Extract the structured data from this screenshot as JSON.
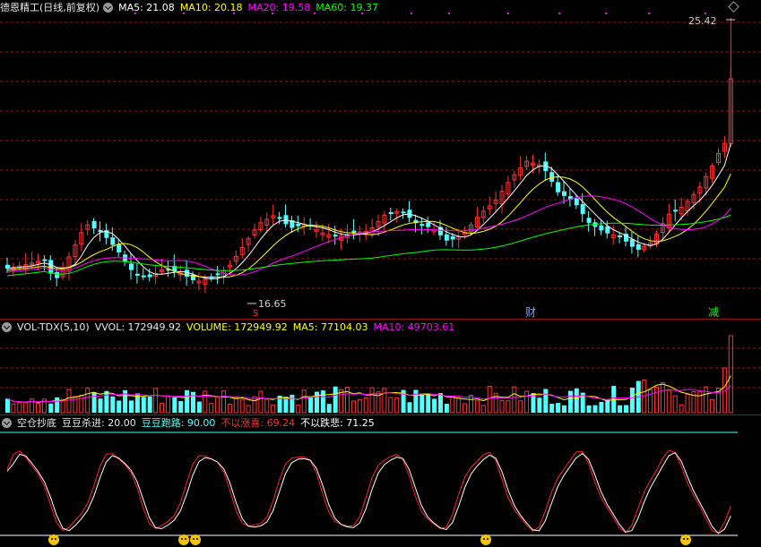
{
  "main": {
    "stock_title": "德恩精工(日线,前复权)",
    "ma5_label": "MA5: 21.08",
    "ma10_label": "MA10: 20.18",
    "ma20_label": "MA20: 19.58",
    "ma60_label": "MA60: 19.37",
    "high_marker": "25.42",
    "low_marker": "16.65",
    "event_cai": "财",
    "event_jian": "减",
    "event_s": "S"
  },
  "volume": {
    "title": "VOL-TDX(5,10)",
    "vvol": "VVOL: 172949.92",
    "volume": "VOLUME: 172949.92",
    "ma5": "MA5: 77104.03",
    "ma10": "MA10: 49703.61"
  },
  "indicator": {
    "title": "空仓抄底",
    "doudou_shajin": "豆豆杀进: 20.00",
    "doudou_paolu": "豆豆跑路: 90.00",
    "buyi_zhangxi": "不以涨喜: 69.24",
    "buyi_diebei": "不以跌悲: 71.25"
  },
  "colors": {
    "up": "#ff3333",
    "down": "#54ffff",
    "ma5": "#ffffff",
    "ma10": "#ffff00",
    "ma20": "#ff00ff",
    "ma60": "#00ff00",
    "grid": "#8b1a1a",
    "smiley": "#f5c400"
  }
}
